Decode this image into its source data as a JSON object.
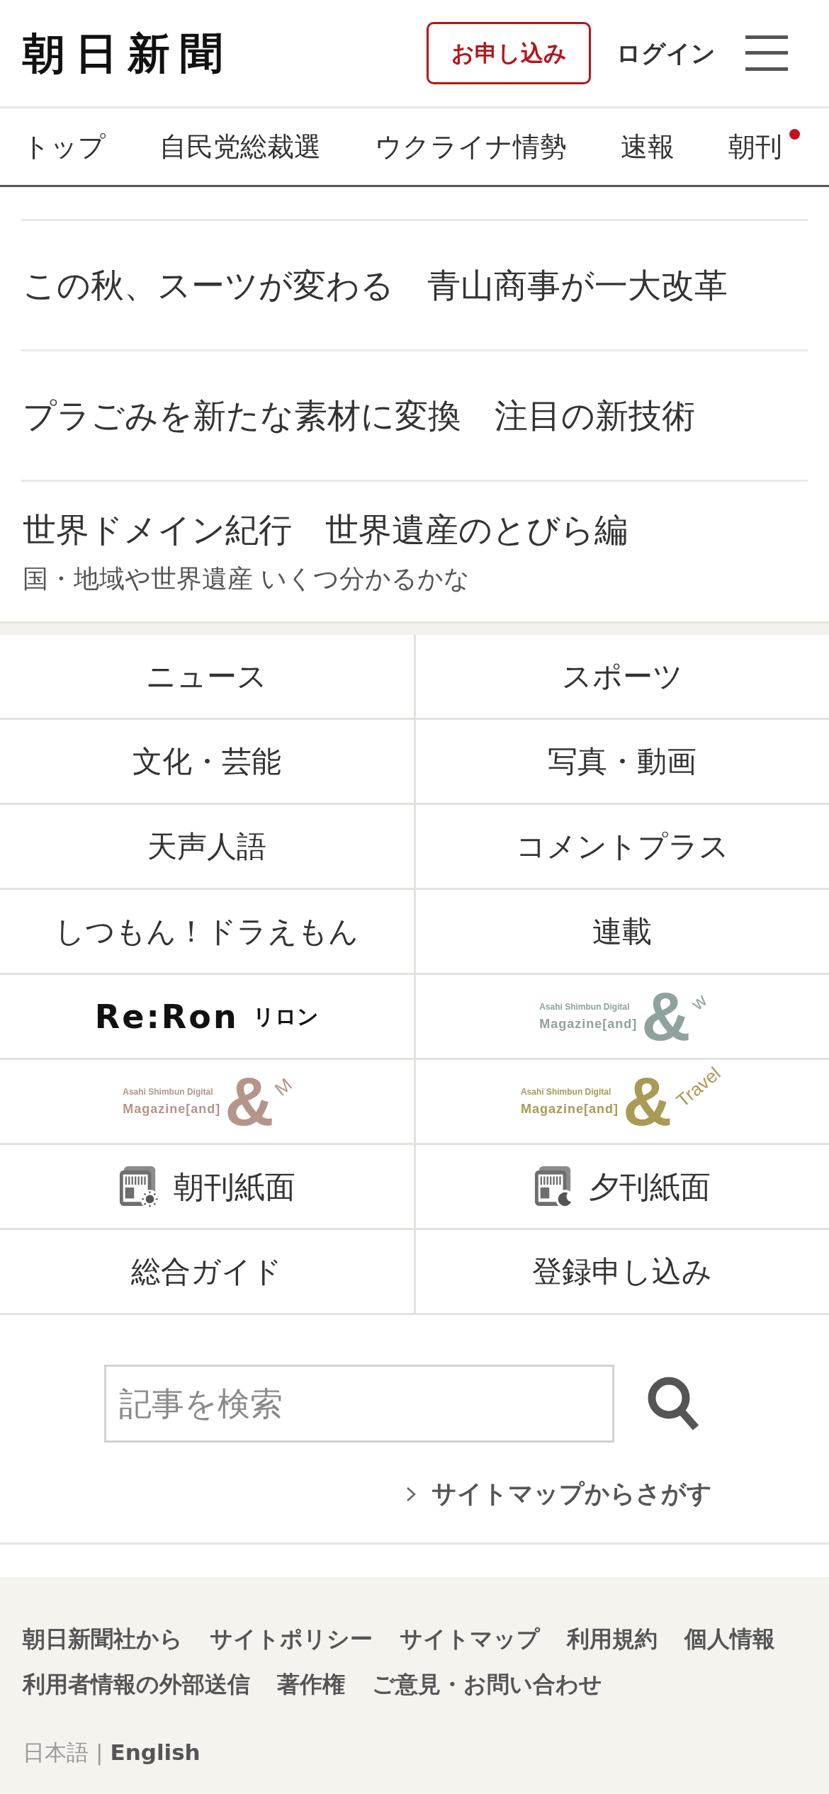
{
  "header": {
    "logo": "朝日新聞",
    "subscribe": "お申し込み",
    "login": "ログイン"
  },
  "nav": [
    {
      "label": "トップ",
      "new": false
    },
    {
      "label": "自民党総裁選",
      "new": false
    },
    {
      "label": "ウクライナ情勢",
      "new": false
    },
    {
      "label": "速報",
      "new": false
    },
    {
      "label": "朝刊",
      "new": true
    }
  ],
  "articles": [
    {
      "title": "この秋、スーツが変わる　青山商事が一大改革"
    },
    {
      "title": "プラごみを新たな素材に変換　注目の新技術"
    },
    {
      "title": "世界ドメイン紀行　世界遺産のとびら編",
      "subtitle": "国・地域や世界遺産 いくつ分かるかな"
    }
  ],
  "grid": [
    {
      "kind": "text",
      "label": "ニュース"
    },
    {
      "kind": "text",
      "label": "スポーツ"
    },
    {
      "kind": "text",
      "label": "文化・芸能"
    },
    {
      "kind": "text",
      "label": "写真・動画"
    },
    {
      "kind": "text",
      "label": "天声人語"
    },
    {
      "kind": "text",
      "label": "コメントプラス"
    },
    {
      "kind": "text",
      "label": "しつもん！ドラえもん"
    },
    {
      "kind": "text",
      "label": "連載"
    },
    {
      "kind": "reron",
      "wordmark": "Re:Ron",
      "kana": "リロン"
    },
    {
      "kind": "magazine",
      "publisher": "Asahi Shimbun Digital",
      "title": "Magazine[and]",
      "mark": "&",
      "suffix": "w",
      "color": "#8fa39e"
    },
    {
      "kind": "magazine",
      "publisher": "Asahi Shimbun Digital",
      "title": "Magazine[and]",
      "mark": "&",
      "suffix": "M",
      "color": "#b3958a"
    },
    {
      "kind": "magazine",
      "publisher": "Asahi Shimbun Digital",
      "title": "Magazine[and]",
      "mark": "&",
      "suffix": "Travel",
      "color": "#a99a55"
    },
    {
      "kind": "morning",
      "label": "朝刊紙面"
    },
    {
      "kind": "evening",
      "label": "夕刊紙面"
    },
    {
      "kind": "text",
      "label": "総合ガイド"
    },
    {
      "kind": "text",
      "label": "登録申し込み"
    }
  ],
  "search": {
    "placeholder": "記事を検索",
    "sitemap_link": "サイトマップからさがす"
  },
  "footer": {
    "links": [
      "朝日新聞社から",
      "サイトポリシー",
      "サイトマップ",
      "利用規約",
      "個人情報",
      "利用者情報の外部送信",
      "著作権",
      "ご意見・お問い合わせ"
    ],
    "languages": [
      {
        "label": "日本語",
        "selected": true
      },
      {
        "label": "English",
        "selected": false
      }
    ],
    "separator": "|"
  }
}
